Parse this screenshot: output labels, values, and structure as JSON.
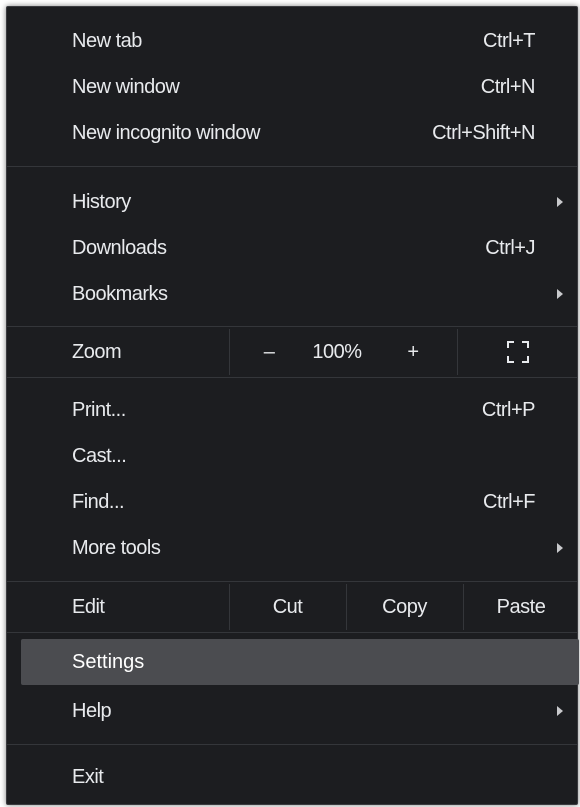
{
  "menu": {
    "new_tab": {
      "label": "New tab",
      "shortcut": "Ctrl+T"
    },
    "new_window": {
      "label": "New window",
      "shortcut": "Ctrl+N"
    },
    "new_incognito": {
      "label": "New incognito window",
      "shortcut": "Ctrl+Shift+N"
    },
    "history": {
      "label": "History"
    },
    "downloads": {
      "label": "Downloads",
      "shortcut": "Ctrl+J"
    },
    "bookmarks": {
      "label": "Bookmarks"
    },
    "zoom": {
      "label": "Zoom",
      "minus": "–",
      "level": "100%",
      "plus": "+"
    },
    "print": {
      "label": "Print...",
      "shortcut": "Ctrl+P"
    },
    "cast": {
      "label": "Cast..."
    },
    "find": {
      "label": "Find...",
      "shortcut": "Ctrl+F"
    },
    "more_tools": {
      "label": "More tools"
    },
    "edit": {
      "label": "Edit",
      "cut": "Cut",
      "copy": "Copy",
      "paste": "Paste"
    },
    "settings": {
      "label": "Settings"
    },
    "help": {
      "label": "Help"
    },
    "exit": {
      "label": "Exit"
    }
  },
  "colors": {
    "background": "#1c1d20",
    "text": "#e8eaed",
    "separator": "#34363a",
    "highlight": "#4b4c50"
  }
}
